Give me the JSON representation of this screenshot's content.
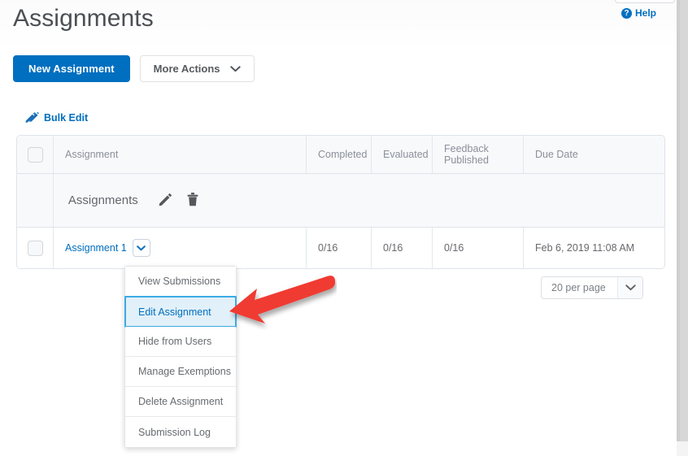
{
  "header": {
    "title": "Assignments",
    "help_label": "Help",
    "help_icon": "question-circle-icon",
    "collapse_icon": "chevron-down-icon"
  },
  "toolbar": {
    "new_assignment_label": "New Assignment",
    "more_actions_label": "More Actions",
    "more_actions_icon": "chevron-down-icon",
    "bulk_edit_label": "Bulk Edit",
    "bulk_edit_icon": "pencils-icon"
  },
  "table": {
    "select_all_icon": "checkbox-icon",
    "columns": [
      {
        "key": "assignment",
        "label": "Assignment"
      },
      {
        "key": "completed",
        "label": "Completed"
      },
      {
        "key": "evaluated",
        "label": "Evaluated"
      },
      {
        "key": "feedback",
        "label": "Feedback Published"
      },
      {
        "key": "due_date",
        "label": "Due Date"
      }
    ],
    "group": {
      "name": "Assignments",
      "edit_icon": "pencil-icon",
      "delete_icon": "trash-icon"
    },
    "rows": [
      {
        "name": "Assignment 1",
        "dropdown_icon": "chevron-down-icon",
        "completed": "0/16",
        "evaluated": "0/16",
        "feedback": "0/16",
        "due_date": "Feb 6, 2019 11:08 AM"
      }
    ]
  },
  "pagination": {
    "per_page_value": "20 per page",
    "per_page_icon": "chevron-down-icon"
  },
  "context_menu": {
    "selected": "Edit Assignment",
    "items": [
      {
        "label": "View Submissions",
        "selected": false
      },
      {
        "label": "Edit Assignment",
        "selected": true
      },
      {
        "label": "Hide from Users",
        "selected": false
      },
      {
        "label": "Manage Exemptions",
        "selected": false
      },
      {
        "label": "Delete Assignment",
        "selected": false
      },
      {
        "label": "Submission Log",
        "selected": false
      }
    ]
  },
  "annotation": {
    "type": "arrow",
    "color": "#f03a31",
    "points_to": "Edit Assignment"
  },
  "colors": {
    "accent": "#006fbf",
    "selected_bg": "#e2f0fa",
    "selected_border": "#3daae4",
    "annotation_red": "#f03a31",
    "table_border": "#dfe3ea",
    "header_bg": "#f8f9fb"
  }
}
